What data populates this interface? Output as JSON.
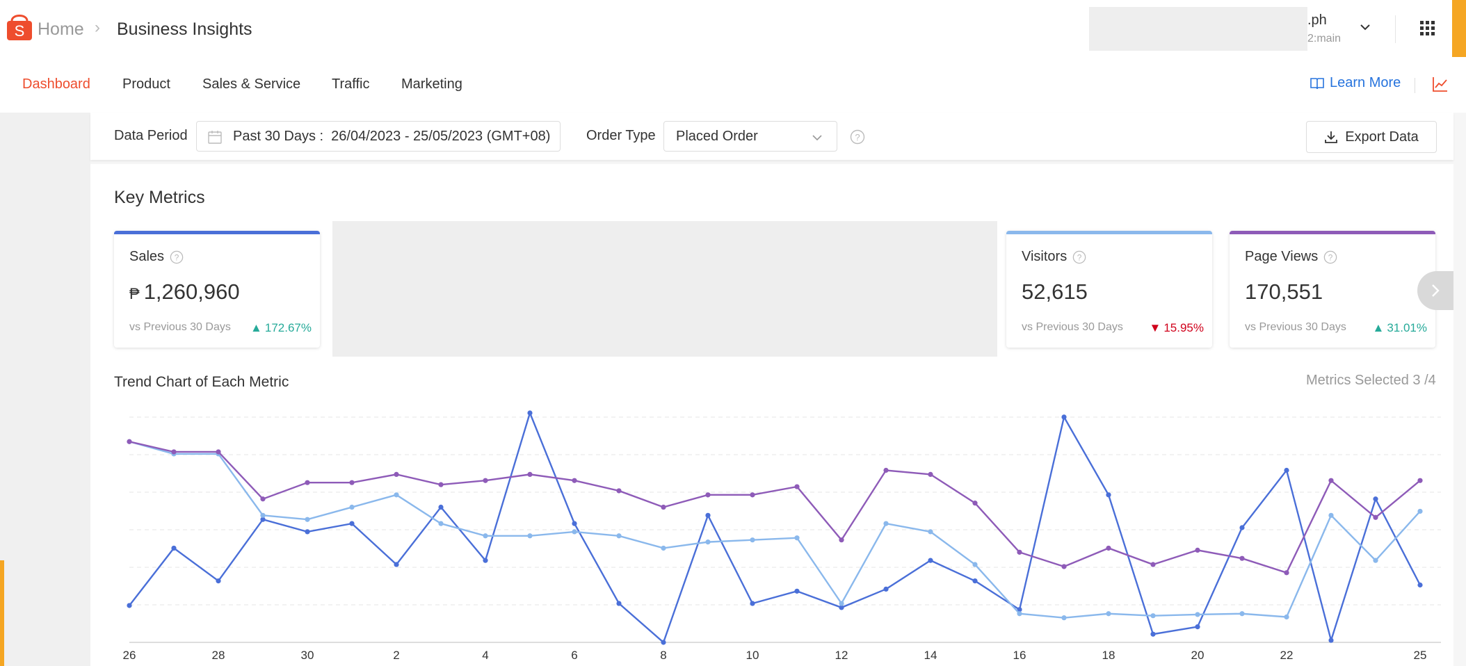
{
  "header": {
    "home": "Home",
    "title": "Business Insights",
    "account_name": ".ph",
    "account_sub": "2:main"
  },
  "tabs": [
    {
      "label": "Dashboard",
      "active": true
    },
    {
      "label": "Product"
    },
    {
      "label": "Sales & Service"
    },
    {
      "label": "Traffic"
    },
    {
      "label": "Marketing"
    }
  ],
  "learn_more": "Learn More",
  "filters": {
    "period_label": "Data Period",
    "period_value": "Past 30 Days :  26/04/2023 - 25/05/2023 (GMT+08)",
    "order_type_label": "Order Type",
    "order_type_value": "Placed Order",
    "export_label": "Export Data"
  },
  "key_metrics": {
    "title": "Key Metrics",
    "vs_label": "vs Previous 30 Days",
    "cards": [
      {
        "name": "Sales",
        "currency": "₱",
        "value": "1,260,960",
        "change": "172.67%",
        "direction": "up",
        "color": "#4a6fd8"
      },
      {
        "name": "Visitors",
        "value": "52,615",
        "change": "15.95%",
        "direction": "down",
        "color": "#8ab8ec"
      },
      {
        "name": "Page Views",
        "value": "170,551",
        "change": "31.01%",
        "direction": "up",
        "color": "#8e5bb8"
      }
    ]
  },
  "trend": {
    "title": "Trend Chart of Each Metric",
    "metrics_selected": "Metrics Selected 3 /4"
  },
  "colors": {
    "accent": "#ee4d2d",
    "link": "#2673dd",
    "up": "#26aa99",
    "down": "#d0011b"
  },
  "chart_data": {
    "type": "line",
    "x": [
      "26",
      "27",
      "28",
      "29",
      "30",
      "1",
      "2",
      "3",
      "4",
      "5",
      "6",
      "7",
      "8",
      "9",
      "10",
      "11",
      "12",
      "13",
      "14",
      "15",
      "16",
      "17",
      "18",
      "19",
      "20",
      "21",
      "22",
      "23",
      "24",
      "25"
    ],
    "tick_labels": [
      "26",
      "28",
      "30",
      "2",
      "4",
      "6",
      "8",
      "10",
      "12",
      "14",
      "16",
      "18",
      "20",
      "22",
      "25"
    ],
    "series": [
      {
        "color": "#4a6fd8",
        "values": [
          0.9,
          2.3,
          1.5,
          3.0,
          2.7,
          2.9,
          1.9,
          3.3,
          2.0,
          5.6,
          2.9,
          0.95,
          0.0,
          3.1,
          0.95,
          1.25,
          0.85,
          1.3,
          2.0,
          1.5,
          0.8,
          5.5,
          3.6,
          0.2,
          0.38,
          2.8,
          4.2,
          0.05,
          3.5,
          1.4
        ]
      },
      {
        "color": "#8ab8ec",
        "values": [
          4.9,
          4.6,
          4.6,
          3.1,
          3.0,
          3.3,
          3.6,
          2.9,
          2.6,
          2.6,
          2.7,
          2.6,
          2.3,
          2.45,
          2.5,
          2.55,
          0.95,
          2.9,
          2.7,
          1.9,
          0.7,
          0.6,
          0.7,
          0.65,
          0.68,
          0.7,
          0.62,
          3.1,
          2.0,
          3.2
        ]
      },
      {
        "color": "#8e5bb8",
        "values": [
          4.9,
          4.65,
          4.65,
          3.5,
          3.9,
          3.9,
          4.1,
          3.85,
          3.95,
          4.1,
          3.95,
          3.7,
          3.3,
          3.6,
          3.6,
          3.8,
          2.5,
          4.2,
          4.1,
          3.4,
          2.2,
          1.85,
          2.3,
          1.9,
          2.25,
          2.05,
          1.7,
          3.95,
          3.05,
          3.95
        ]
      }
    ]
  }
}
